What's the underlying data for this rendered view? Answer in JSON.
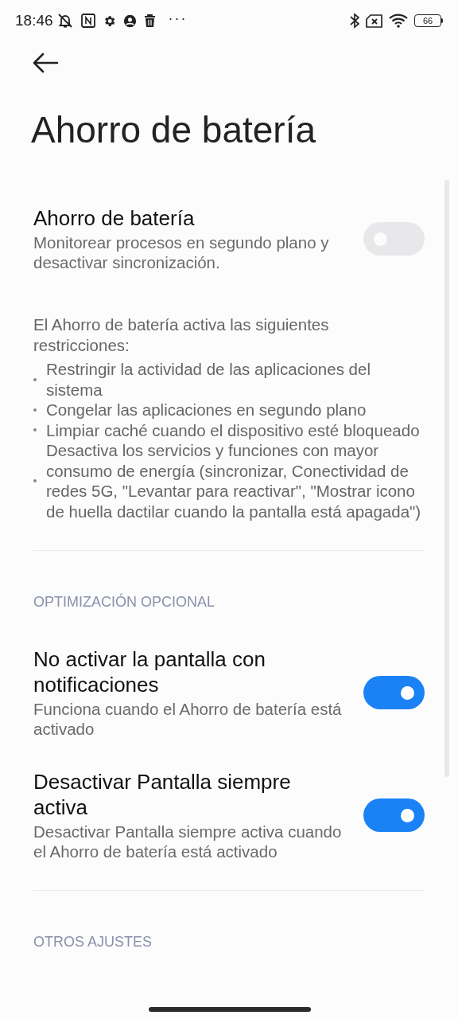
{
  "status_bar": {
    "time": "18:46",
    "more": "···",
    "battery": "66"
  },
  "title": "Ahorro de batería",
  "main_switch": {
    "title": "Ahorro de batería",
    "summary": "Monitorear procesos en segundo plano y desactivar sincronización.",
    "on": false
  },
  "restrictions": {
    "intro": "El Ahorro de batería activa las siguientes restricciones:",
    "items": [
      "Restringir la actividad de las aplicaciones del sistema",
      "Congelar las aplicaciones en segundo plano",
      "Limpiar caché cuando el dispositivo esté bloqueado",
      "Desactiva los servicios y funciones con mayor consumo de energía (sincronizar, Conectividad de redes 5G, \"Levantar para reactivar\", \"Mostrar icono de huella dactilar cuando la pantalla está apagada\")"
    ]
  },
  "sections": [
    {
      "header": "OPTIMIZACIÓN OPCIONAL",
      "items": [
        {
          "title": "No activar la pantalla con notificaciones",
          "summary": "Funciona cuando el Ahorro de batería está activado",
          "on": true
        },
        {
          "title": "Desactivar Pantalla siempre activa",
          "summary": "Desactivar Pantalla siempre activa cuando el Ahorro de batería está activado",
          "on": true
        }
      ]
    },
    {
      "header": "OTROS AJUSTES"
    }
  ]
}
